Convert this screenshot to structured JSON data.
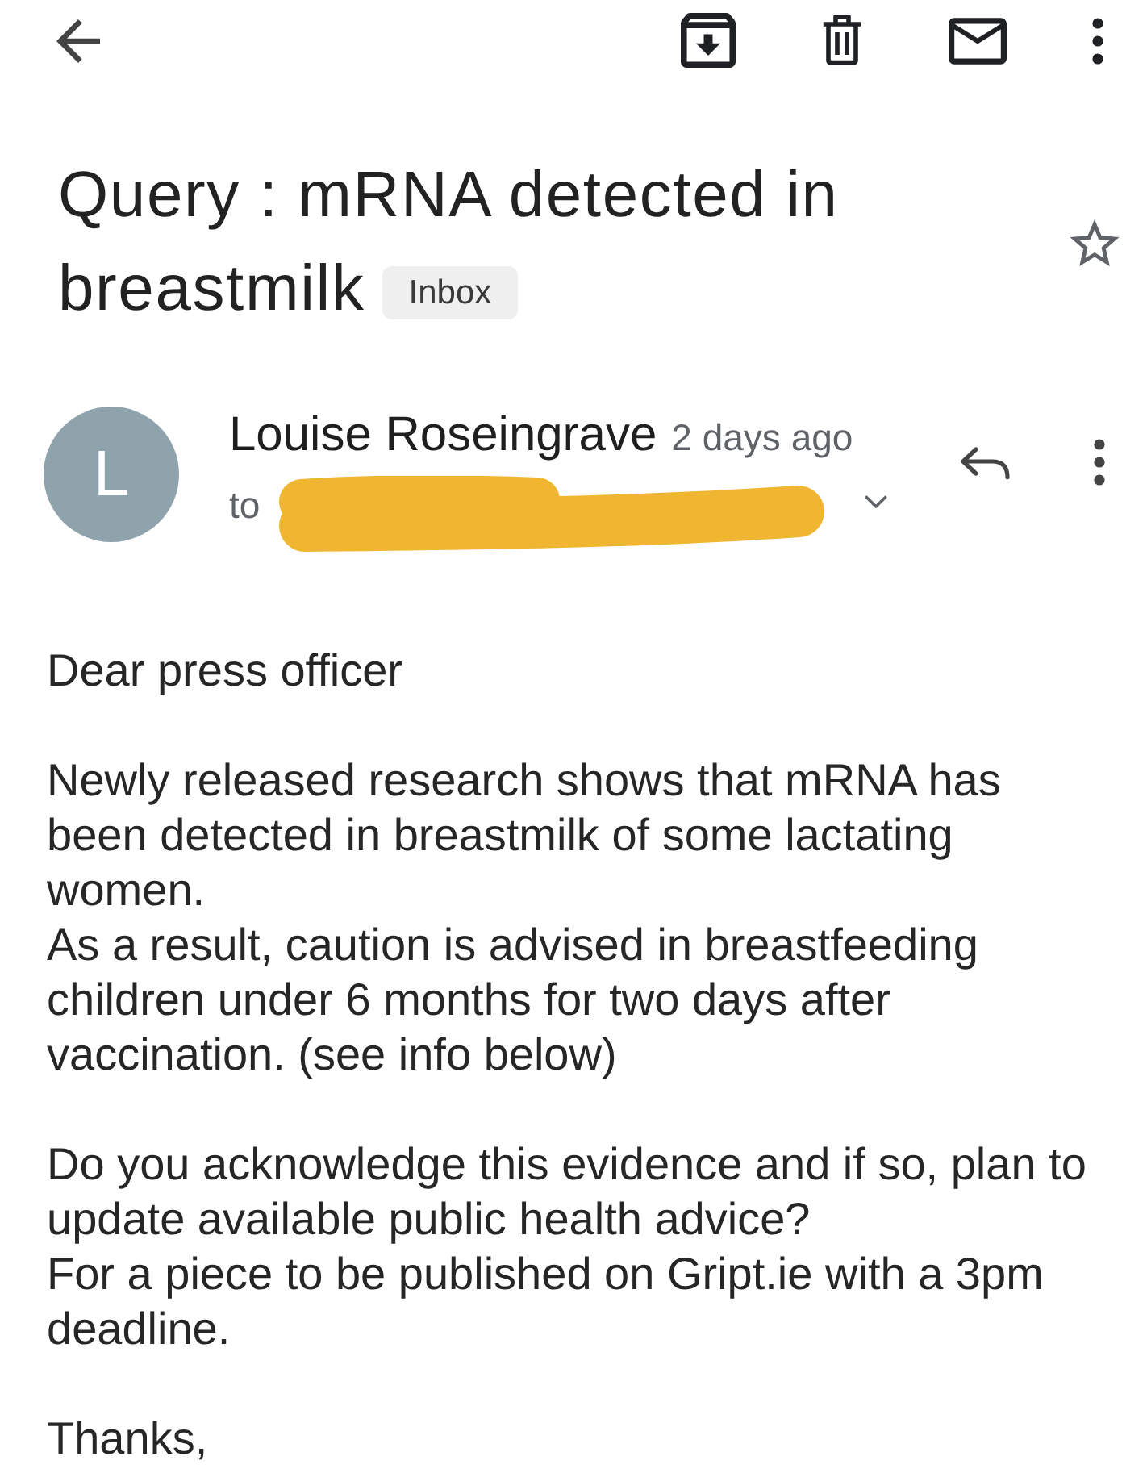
{
  "subject": {
    "title_lines": [
      "Query : mRNA detected in",
      "breastmilk"
    ],
    "label": "Inbox",
    "starred": false
  },
  "message": {
    "sender": {
      "initial": "L",
      "name": "Louise Roseingrave",
      "time": "2 days ago"
    },
    "recipient": {
      "prefix": "to",
      "redacted": true
    },
    "body": [
      {
        "lines": [
          "Dear press officer"
        ]
      },
      {
        "lines": [
          "Newly released research shows that mRNA has been detected in breastmilk of some lactating women.",
          "As a result, caution is advised in breastfeeding children under 6 months for two days after vaccination. (see info below)"
        ]
      },
      {
        "lines": [
          "Do you acknowledge this evidence and if so, plan to update available public health advice?",
          "For a piece to be published on Gript.ie with a 3pm deadline."
        ]
      },
      {
        "lines": [
          "Thanks,"
        ]
      }
    ]
  }
}
